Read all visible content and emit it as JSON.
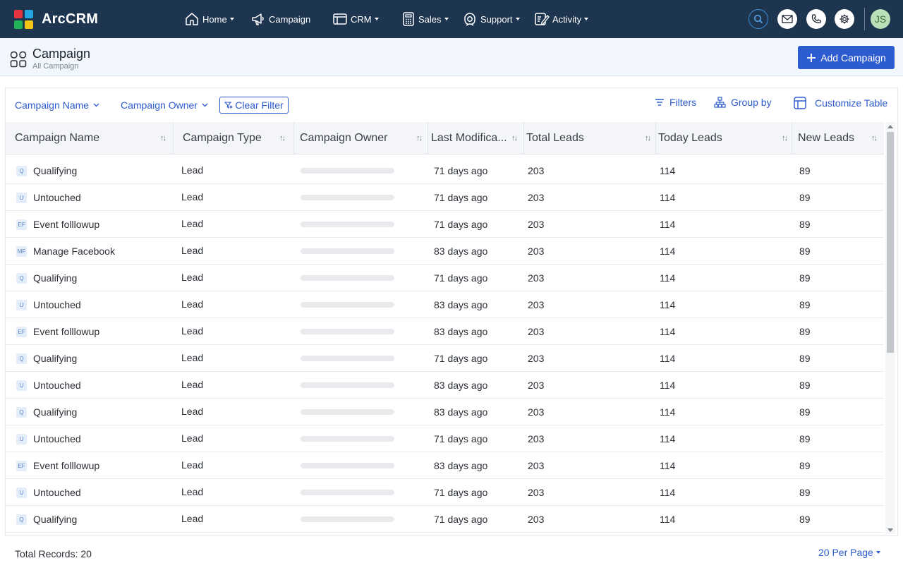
{
  "app": {
    "name": "ArcCRM",
    "avatar_initials": "JS"
  },
  "nav": {
    "home": "Home",
    "campaign": "Campaign",
    "crm": "CRM",
    "sales": "Sales",
    "support": "Support",
    "activity": "Activity"
  },
  "header": {
    "title": "Campaign",
    "subtitle": "All Campaign",
    "add_label": "Add Campaign"
  },
  "filters": {
    "campaign_name": "Campaign Name",
    "campaign_owner": "Campaign Owner",
    "clear": "Clear Filter",
    "filters": "Filters",
    "group_by": "Group by",
    "customize": "Customize Table"
  },
  "table": {
    "columns": [
      "Campaign Name",
      "Campaign Type",
      "Campaign Owner",
      "Last Modifica...",
      "Total Leads",
      "Today Leads",
      "New Leads"
    ],
    "rows": [
      {
        "badge": "Q",
        "name": "Qualifying",
        "type": "Lead",
        "modified": "71 days ago",
        "total": "203",
        "today": "114",
        "new": "89"
      },
      {
        "badge": "U",
        "name": "Untouched",
        "type": "Lead",
        "modified": "71 days ago",
        "total": "203",
        "today": "114",
        "new": "89"
      },
      {
        "badge": "EF",
        "name": "Event folllowup",
        "type": "Lead",
        "modified": "71 days ago",
        "total": "203",
        "today": "114",
        "new": "89"
      },
      {
        "badge": "MF",
        "name": "Manage Facebook",
        "type": "Lead",
        "modified": "83 days ago",
        "total": "203",
        "today": "114",
        "new": "89"
      },
      {
        "badge": "Q",
        "name": "Qualifying",
        "type": "Lead",
        "modified": "71 days ago",
        "total": "203",
        "today": "114",
        "new": "89"
      },
      {
        "badge": "U",
        "name": "Untouched",
        "type": "Lead",
        "modified": "83 days ago",
        "total": "203",
        "today": "114",
        "new": "89"
      },
      {
        "badge": "EF",
        "name": "Event folllowup",
        "type": "Lead",
        "modified": "83 days ago",
        "total": "203",
        "today": "114",
        "new": "89"
      },
      {
        "badge": "Q",
        "name": "Qualifying",
        "type": "Lead",
        "modified": "71 days ago",
        "total": "203",
        "today": "114",
        "new": "89"
      },
      {
        "badge": "U",
        "name": "Untouched",
        "type": "Lead",
        "modified": "83 days ago",
        "total": "203",
        "today": "114",
        "new": "89"
      },
      {
        "badge": "Q",
        "name": "Qualifying",
        "type": "Lead",
        "modified": "83 days ago",
        "total": "203",
        "today": "114",
        "new": "89"
      },
      {
        "badge": "U",
        "name": "Untouched",
        "type": "Lead",
        "modified": "71 days ago",
        "total": "203",
        "today": "114",
        "new": "89"
      },
      {
        "badge": "EF",
        "name": "Event folllowup",
        "type": "Lead",
        "modified": "83 days ago",
        "total": "203",
        "today": "114",
        "new": "89"
      },
      {
        "badge": "U",
        "name": "Untouched",
        "type": "Lead",
        "modified": "71 days ago",
        "total": "203",
        "today": "114",
        "new": "89"
      },
      {
        "badge": "Q",
        "name": "Qualifying",
        "type": "Lead",
        "modified": "71 days ago",
        "total": "203",
        "today": "114",
        "new": "89"
      }
    ]
  },
  "footer": {
    "total_records": "Total Records: 20",
    "per_page": "20 Per Page"
  }
}
